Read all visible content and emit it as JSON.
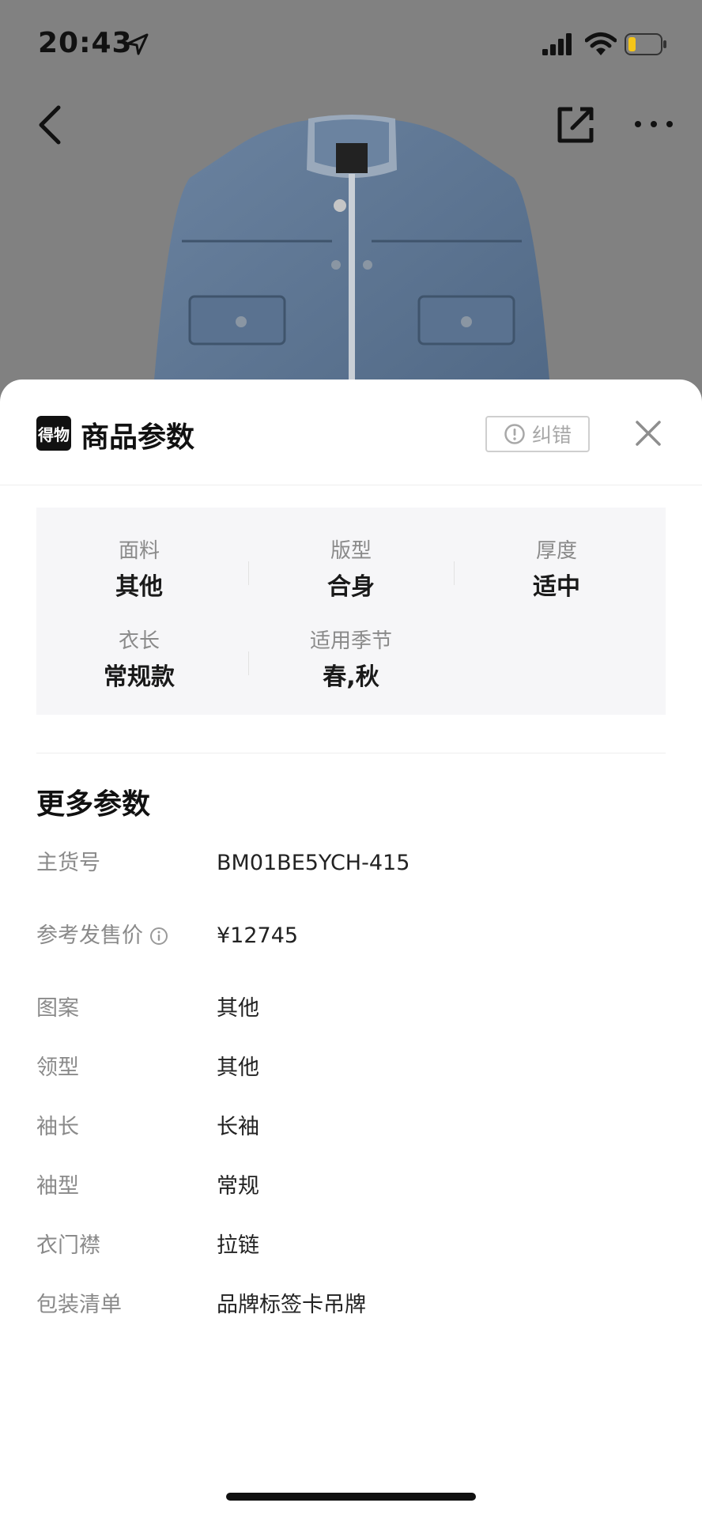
{
  "status_bar": {
    "time": "20:43"
  },
  "colors": {
    "overlay_bg": "#818181",
    "sheet_bg": "#ffffff",
    "spec_bg": "#f6f6f8",
    "denim": "#5f7894",
    "battery_fill": "#f5c518"
  },
  "nav": {
    "back_icon": "chevron-left-icon",
    "share_icon": "share-external-icon",
    "more_icon": "more-dots-icon"
  },
  "sheet": {
    "logo_text": "得物",
    "title": "商品参数",
    "report_label": "纠错",
    "close_icon": "close-icon"
  },
  "specs": [
    {
      "label": "面料",
      "value": "其他"
    },
    {
      "label": "版型",
      "value": "合身"
    },
    {
      "label": "厚度",
      "value": "适中"
    },
    {
      "label": "衣长",
      "value": "常规款"
    },
    {
      "label": "适用季节",
      "value": "春,秋"
    }
  ],
  "more_params": {
    "title": "更多参数",
    "rows": [
      {
        "key": "主货号",
        "value": "BM01BE5YCH-415"
      },
      {
        "key": "参考发售价",
        "value": "¥12745"
      },
      {
        "key": "图案",
        "value": "其他"
      },
      {
        "key": "领型",
        "value": "其他"
      },
      {
        "key": "袖长",
        "value": "长袖"
      },
      {
        "key": "袖型",
        "value": "常规"
      },
      {
        "key": "衣门襟",
        "value": "拉链"
      },
      {
        "key": "包装清单",
        "value": "品牌标签卡吊牌"
      }
    ]
  }
}
